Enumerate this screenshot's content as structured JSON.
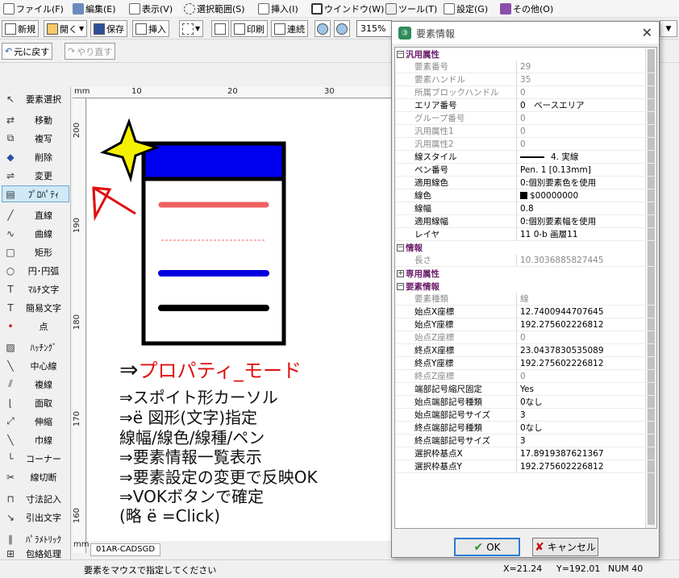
{
  "menu": [
    {
      "label": "ファイル(F)",
      "icon": "file-icon"
    },
    {
      "label": "編集(E)",
      "icon": "edit-icon"
    },
    {
      "label": "表示(V)",
      "icon": "view-icon"
    },
    {
      "label": "選択範囲(S)",
      "icon": "selection-icon"
    },
    {
      "label": "挿入(I)",
      "icon": "insert-icon"
    },
    {
      "label": "ウインドウ(W)",
      "icon": "window-icon"
    },
    {
      "label": "ツール(T)",
      "icon": "tools-icon"
    },
    {
      "label": "設定(G)",
      "icon": "settings-icon"
    },
    {
      "label": "その他(O)",
      "icon": "other-icon"
    }
  ],
  "toolbar": {
    "new": "新規",
    "open": "開く",
    "save": "保存",
    "insert": "挿入",
    "print": "印刷",
    "continuous": "連続",
    "zoom": "315%",
    "undo": "元に戻す",
    "redo": "やり直す"
  },
  "tools": [
    "要素選択",
    "移動",
    "複写",
    "削除",
    "変更",
    "ﾌﾟﾛﾊﾟﾃｨ",
    "直線",
    "曲線",
    "矩形",
    "円･円弧",
    "ﾏﾙﾁ文字",
    "簡易文字",
    "点",
    "ﾊｯﾁﾝｸﾞ",
    "中心線",
    "複線",
    "面取",
    "伸縮",
    "巾線",
    "コーナー",
    "線切断",
    "寸法記入",
    "引出文字",
    "ﾊﾟﾗﾒﾄﾘｯｸ",
    "包絡処理"
  ],
  "ruler": {
    "unit": "mm",
    "top_ticks": [
      "10",
      "20",
      "30"
    ],
    "left_ticks": [
      "200",
      "190",
      "180",
      "170",
      "160"
    ]
  },
  "canvas_notes": {
    "title": "⇒プロパティ_モード",
    "lines": [
      "⇒スポイト形カーソル",
      "⇒ë 図形(文字)指定",
      "線幅/線色/線種/ペン",
      "⇒要素情報一覧表示",
      "⇒要素設定の変更で反映OK",
      "⇒VOKボタンで確定",
      "(略 ë =Click)"
    ]
  },
  "doc_tab": "01AR-CADSGD",
  "status": {
    "message": "要素をマウスで指定してください",
    "x": "X=21.24",
    "y": "Y=192.01",
    "num": "NUM 40"
  },
  "dialog": {
    "title": "要素情報",
    "ok": "OK",
    "cancel": "キャンセル",
    "sections": [
      {
        "name": "汎用属性",
        "expanded": true,
        "rows": [
          {
            "key": "要素番号",
            "value": "29",
            "dim": true
          },
          {
            "key": "要素ハンドル",
            "value": "35",
            "dim": true
          },
          {
            "key": "所属ブロックハンドル",
            "value": "0",
            "dim": true
          },
          {
            "key": "エリア番号",
            "value": "0　ベースエリア"
          },
          {
            "key": "グループ番号",
            "value": "0",
            "dim": true
          },
          {
            "key": "汎用属性1",
            "value": "0",
            "dim": true
          },
          {
            "key": "汎用属性2",
            "value": "0",
            "dim": true
          },
          {
            "key": "線スタイル",
            "value": "4. 実線",
            "swatch": "line"
          },
          {
            "key": "ペン番号",
            "value": "Pen. 1 [0.13mm]"
          },
          {
            "key": "適用線色",
            "value": "0:個別要素色を使用"
          },
          {
            "key": "線色",
            "value": "$00000000",
            "swatch": "color"
          },
          {
            "key": "線幅",
            "value": "0.8"
          },
          {
            "key": "適用線幅",
            "value": "0:個別要素幅を使用"
          },
          {
            "key": "レイヤ",
            "value": "11  0-b 画層11"
          }
        ]
      },
      {
        "name": "情報",
        "expanded": true,
        "rows": [
          {
            "key": "長さ",
            "value": "10.3036885827445",
            "dim": true
          }
        ]
      },
      {
        "name": "専用属性",
        "expanded": false,
        "rows": []
      },
      {
        "name": "要素情報",
        "expanded": true,
        "rows": [
          {
            "key": "要素種類",
            "value": "線",
            "dim": true
          },
          {
            "key": "始点X座標",
            "value": "12.7400944707645"
          },
          {
            "key": "始点Y座標",
            "value": "192.275602226812"
          },
          {
            "key": "始点Z座標",
            "value": "0",
            "dim": true
          },
          {
            "key": "終点X座標",
            "value": "23.0437830535089"
          },
          {
            "key": "終点Y座標",
            "value": "192.275602226812"
          },
          {
            "key": "終点Z座標",
            "value": "0",
            "dim": true
          },
          {
            "key": "端部記号縮尺固定",
            "value": "Yes"
          },
          {
            "key": "始点端部記号種類",
            "value": "0なし"
          },
          {
            "key": "始点端部記号サイズ",
            "value": "3"
          },
          {
            "key": "終点端部記号種類",
            "value": "0なし"
          },
          {
            "key": "終点端部記号サイズ",
            "value": "3"
          },
          {
            "key": "選択枠基点X",
            "value": "17.8919387621367"
          },
          {
            "key": "選択枠基点Y",
            "value": "192.275602226812"
          }
        ]
      }
    ]
  }
}
